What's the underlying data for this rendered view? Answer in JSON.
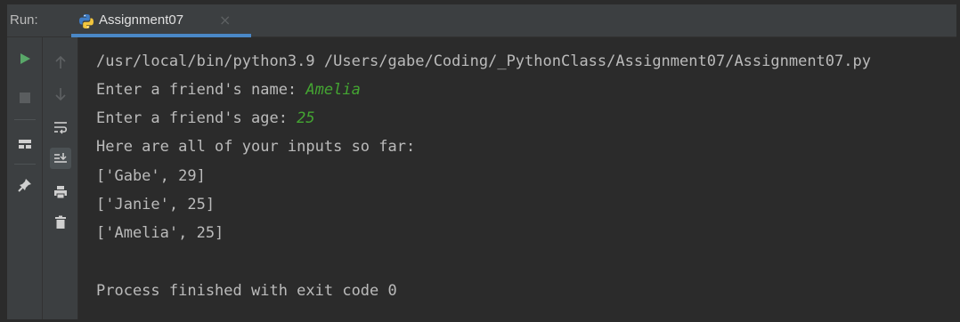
{
  "header": {
    "run_label": "Run:",
    "tab_title": "Assignment07",
    "tab_close": "×"
  },
  "toolbar": {
    "left_icons": [
      "rerun-icon",
      "stop-icon",
      "layout-icon",
      "pin-icon"
    ],
    "right_icons": [
      "scroll-up-icon",
      "scroll-down-icon",
      "soft-wrap-icon",
      "scroll-to-end-icon",
      "print-icon",
      "trash-icon"
    ]
  },
  "console": {
    "command": "/usr/local/bin/python3.9 /Users/gabe/Coding/_PythonClass/Assignment07/Assignment07.py",
    "prompt_name": "Enter a friend's name: ",
    "input_name": "Amelia",
    "prompt_age": "Enter a friend's age: ",
    "input_age": "25",
    "summary": "Here are all of your inputs so far:",
    "entries": [
      "['Gabe', 29]",
      "['Janie', 25]",
      "['Amelia', 25]"
    ],
    "exit_message": "Process finished with exit code 0"
  },
  "colors": {
    "background": "#2b2b2b",
    "panel": "#3c3f41",
    "accent": "#4a88c7",
    "text": "#bbbbbb",
    "input": "#44a532",
    "run_green": "#59a869"
  }
}
